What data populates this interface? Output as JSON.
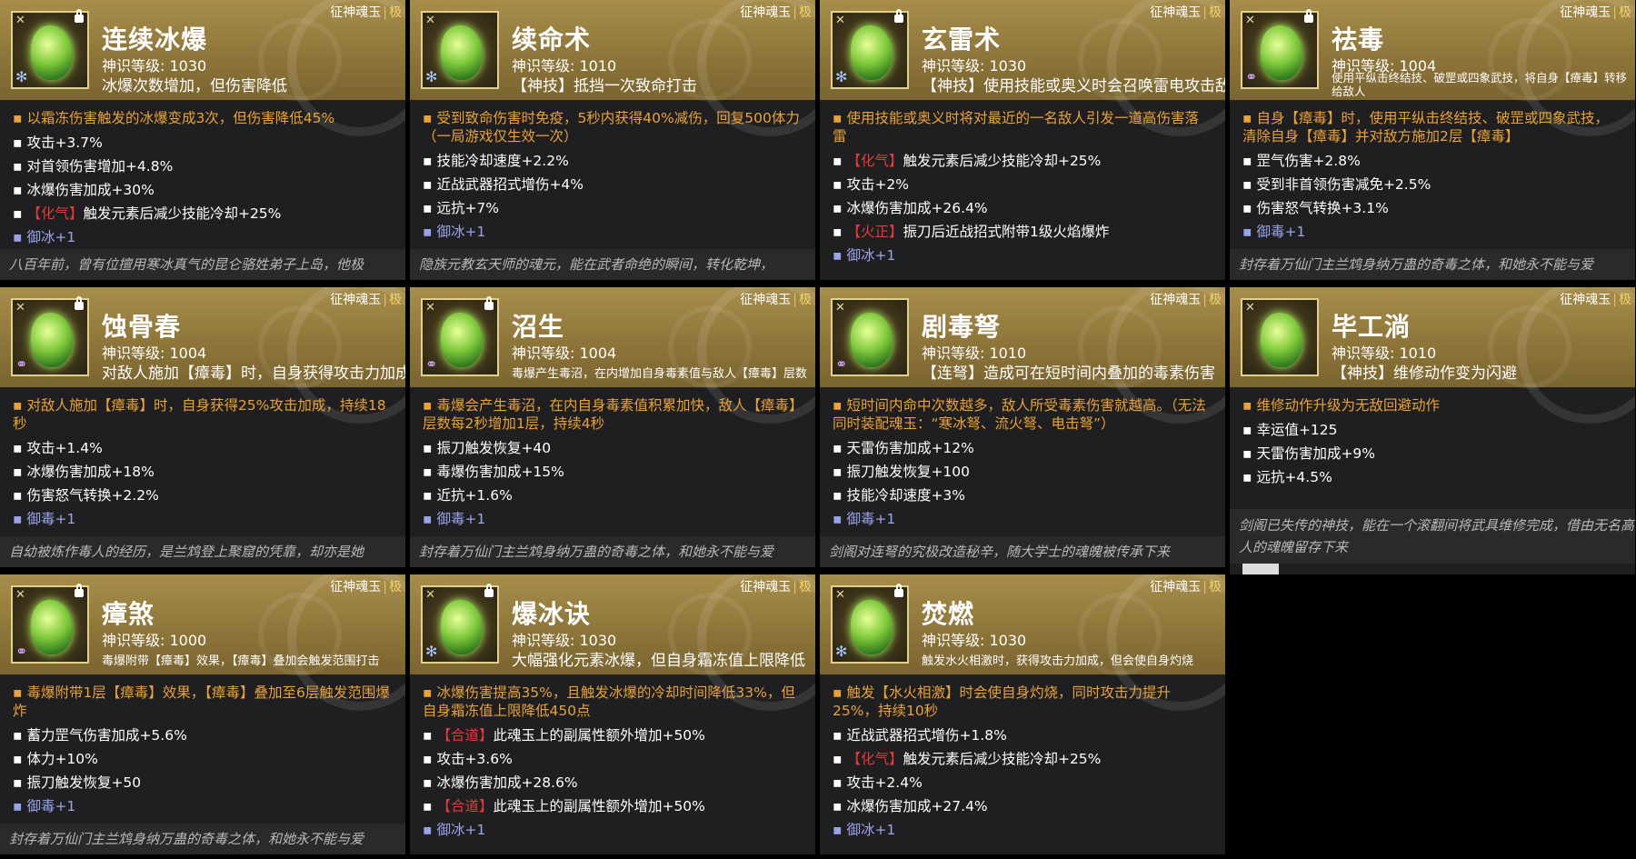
{
  "rank_label": "征神魂玉",
  "rank_grade": "极",
  "cards": [
    {
      "name": "连续冰爆",
      "level": "神识等级: 1030",
      "sub": "冰爆次数增加，但伤害降低",
      "element": "ice",
      "locked": true,
      "main": "以霜冻伤害触发的冰爆变成3次，但伤害降低45%",
      "stats": [
        {
          "tag": "",
          "text": "攻击+3.7%"
        },
        {
          "tag": "",
          "text": "对首领伤害增加+4.8%"
        },
        {
          "tag": "",
          "text": "冰爆伤害加成+30%"
        },
        {
          "tag": "【化气】",
          "text": "触发元素后减少技能冷却+25%"
        }
      ],
      "yu": "御冰+1",
      "flavor": "八百年前，曾有位擅用寒冰真气的昆仑骆姓弟子上岛，他极"
    },
    {
      "name": "续命术",
      "level": "神识等级: 1010",
      "sub": "【神技】抵挡一次致命打击",
      "element": "ice",
      "locked": false,
      "main": "受到致命伤害时免疫，5秒内获得40%减伤，回复500体力（一局游戏仅生效一次）",
      "stats": [
        {
          "tag": "",
          "text": "技能冷却速度+2.2%"
        },
        {
          "tag": "",
          "text": "近战武器招式增伤+4%"
        },
        {
          "tag": "",
          "text": "远抗+7%"
        }
      ],
      "yu": "御冰+1",
      "flavor": "隐族元教玄天师的魂元，能在武者命绝的瞬间，转化乾坤，"
    },
    {
      "name": "玄雷术",
      "level": "神识等级: 1030",
      "sub": "【神技】使用技能或奥义时会召唤雷电攻击敌人",
      "element": "ice",
      "locked": true,
      "main": "使用技能或奥义时将对最近的一名敌人引发一道高伤害落雷",
      "stats": [
        {
          "tag": "【化气】",
          "text": "触发元素后减少技能冷却+25%"
        },
        {
          "tag": "",
          "text": "攻击+2%"
        },
        {
          "tag": "",
          "text": "冰爆伤害加成+26.4%"
        },
        {
          "tag": "【火正】",
          "text": "振刀后近战招式附带1级火焰爆炸"
        }
      ],
      "yu": "御冰+1",
      "flavor": ""
    },
    {
      "name": "祛毒",
      "level": "神识等级: 1004",
      "sub": "使用平纵击终结技、破罡或四象武技，将自身【瘴毒】转移给敌人",
      "element": "poison",
      "locked": true,
      "main": "自身【瘴毒】时，使用平纵击终结技、破罡或四象武技，清除自身【瘴毒】并对敌方施加2层【瘴毒】",
      "stats": [
        {
          "tag": "",
          "text": "罡气伤害+2.8%"
        },
        {
          "tag": "",
          "text": "受到非首领伤害减免+2.5%"
        },
        {
          "tag": "",
          "text": "伤害怒气转换+3.1%"
        }
      ],
      "yu": "御毒+1",
      "flavor": "封存着万仙门主兰鸩身纳万蛊的奇毒之体，和她永不能与爱"
    },
    {
      "name": "蚀骨春",
      "level": "神识等级: 1004",
      "sub": "对敌人施加【瘴毒】时，自身获得攻击力加成",
      "element": "poison",
      "locked": true,
      "main": "对敌人施加【瘴毒】时，自身获得25%攻击加成，持续18秒",
      "stats": [
        {
          "tag": "",
          "text": "攻击+1.4%"
        },
        {
          "tag": "",
          "text": "冰爆伤害加成+18%"
        },
        {
          "tag": "",
          "text": "伤害怒气转换+2.2%"
        }
      ],
      "yu": "御毒+1",
      "flavor": "自幼被炼作毒人的经历，是兰鸩登上聚窟的凭靠，却亦是她"
    },
    {
      "name": "沼生",
      "level": "神识等级: 1004",
      "sub": "毒爆产生毒沼，在内增加自身毒素值与敌人【瘴毒】层数",
      "element": "poison",
      "locked": true,
      "main": "毒爆会产生毒沼，在内自身毒素值积累加快，敌人【瘴毒】层数每2秒增加1层，持续4秒",
      "stats": [
        {
          "tag": "",
          "text": "振刀触发恢复+40"
        },
        {
          "tag": "",
          "text": "毒爆伤害加成+15%"
        },
        {
          "tag": "",
          "text": "近抗+1.6%"
        }
      ],
      "yu": "御毒+1",
      "flavor": "封存着万仙门主兰鸩身纳万蛊的奇毒之体，和她永不能与爱"
    },
    {
      "name": "剧毒弩",
      "level": "神识等级: 1010",
      "sub": "【连弩】造成可在短时间内叠加的毒素伤害",
      "element": "poison",
      "locked": false,
      "main": "短时间内命中次数越多，敌人所受毒素伤害就越高。（无法同时装配魂玉：“寒冰弩、流火弩、电击弩”）",
      "stats": [
        {
          "tag": "",
          "text": "天雷伤害加成+12%"
        },
        {
          "tag": "",
          "text": "振刀触发恢复+100"
        },
        {
          "tag": "",
          "text": "技能冷却速度+3%"
        }
      ],
      "yu": "御毒+1",
      "flavor": "剑阁对连弩的究极改造秘辛，随大学士的魂魄被传承下来"
    },
    {
      "name": "毕工淌",
      "level": "神识等级: 1010",
      "sub": "【神技】维修动作变为闪避",
      "element": "none",
      "locked": false,
      "main": "维修动作升级为无敌回避动作",
      "stats": [
        {
          "tag": "",
          "text": "幸运值+125"
        },
        {
          "tag": "",
          "text": "天雷伤害加成+9%"
        },
        {
          "tag": "",
          "text": "远抗+4.5%"
        }
      ],
      "yu": "",
      "flavor": "剑阁已失传的神技，能在一个滚翻间将武具维修完成，借由无名高人的魂魄留存下来"
    },
    {
      "name": "瘴煞",
      "level": "神识等级: 1000",
      "sub": "毒爆附带【瘴毒】效果，【瘴毒】叠加会触发范围打击",
      "element": "poison",
      "locked": true,
      "main": "毒爆附带1层【瘴毒】效果，【瘴毒】叠加至6层触发范围爆炸",
      "stats": [
        {
          "tag": "",
          "text": "蓄力罡气伤害加成+5.6%"
        },
        {
          "tag": "",
          "text": "体力+10%"
        },
        {
          "tag": "",
          "text": "振刀触发恢复+50"
        }
      ],
      "yu": "御毒+1",
      "flavor": "封存着万仙门主兰鸩身纳万蛊的奇毒之体，和她永不能与爱"
    },
    {
      "name": "爆冰诀",
      "level": "神识等级: 1030",
      "sub": "大幅强化元素冰爆，但自身霜冻值上限降低",
      "element": "ice",
      "locked": true,
      "main": "冰爆伤害提高35%，且触发冰爆的冷却时间降低33%，但自身霜冻值上限降低450点",
      "stats": [
        {
          "tag": "【合道】",
          "text": "此魂玉上的副属性额外增加+50%"
        },
        {
          "tag": "",
          "text": "攻击+3.6%"
        },
        {
          "tag": "",
          "text": "冰爆伤害加成+28.6%"
        },
        {
          "tag": "【合道】",
          "text": "此魂玉上的副属性额外增加+50%"
        }
      ],
      "yu": "御冰+1",
      "flavor": ""
    },
    {
      "name": "焚燃",
      "level": "神识等级: 1030",
      "sub": "触发水火相激时，获得攻击力加成，但会使自身灼烧",
      "element": "ice",
      "locked": true,
      "main": "触发【水火相激】时会使自身灼烧，同时攻击力提升25%，持续10秒",
      "stats": [
        {
          "tag": "",
          "text": "近战武器招式增伤+1.8%"
        },
        {
          "tag": "【化气】",
          "text": "触发元素后减少技能冷却+25%"
        },
        {
          "tag": "",
          "text": "攻击+2.4%"
        },
        {
          "tag": "",
          "text": "冰爆伤害加成+27.4%"
        }
      ],
      "yu": "御冰+1",
      "flavor": ""
    }
  ]
}
